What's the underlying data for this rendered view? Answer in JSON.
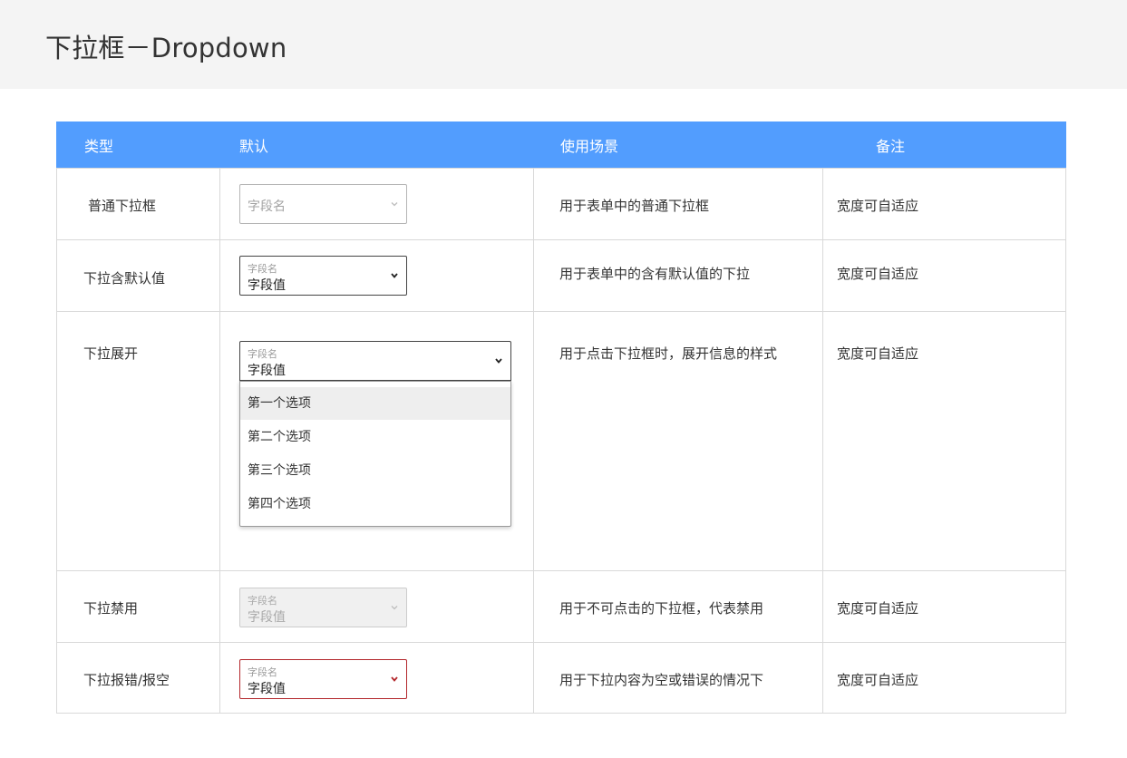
{
  "page": {
    "title": "下拉框－Dropdown"
  },
  "table": {
    "headers": [
      "类型",
      "默认",
      "使用场景",
      "备注"
    ],
    "rows": [
      {
        "type": "普通下拉框",
        "dropdown": {
          "placeholder": "字段名"
        },
        "scene": "用于表单中的普通下拉框",
        "note": "宽度可自适应"
      },
      {
        "type": "下拉含默认值",
        "dropdown": {
          "label": "字段名",
          "value": "字段值"
        },
        "scene": "用于表单中的含有默认值的下拉",
        "note": "宽度可自适应"
      },
      {
        "type": "下拉展开",
        "dropdown": {
          "label": "字段名",
          "value": "字段值",
          "options": [
            "第一个选项",
            "第二个选项",
            "第三个选项",
            "第四个选项"
          ],
          "highlighted_option": "第一个选项"
        },
        "scene": "用于点击下拉框时，展开信息的样式",
        "note": "宽度可自适应"
      },
      {
        "type": "下拉禁用",
        "dropdown": {
          "label": "字段名",
          "value": "字段值"
        },
        "scene": "用于不可点击的下拉框，代表禁用",
        "note": "宽度可自适应"
      },
      {
        "type": "下拉报错/报空",
        "dropdown": {
          "label": "字段名",
          "value": "字段值"
        },
        "scene": "用于下拉内容为空或错误的情况下",
        "note": "宽度可自适应"
      }
    ]
  },
  "colors": {
    "header_bar": "#529dfe",
    "page_header_bg": "#f4f4f4",
    "error": "#b3262b",
    "border": "#d9d9d9"
  },
  "icons": {
    "dropdown_arrow": "chevron-down-icon"
  }
}
